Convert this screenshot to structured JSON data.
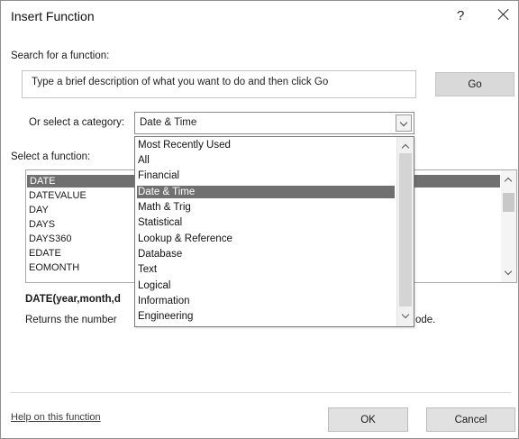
{
  "dialog": {
    "title": "Insert Function",
    "help_label": "?"
  },
  "search": {
    "label": "Search for a function:",
    "value": "Type a brief description of what you want to do and then click Go",
    "go_label": "Go"
  },
  "category": {
    "label": "Or select a category:",
    "selected": "Date & Time",
    "options": [
      "Most Recently Used",
      "All",
      "Financial",
      "Date & Time",
      "Math & Trig",
      "Statistical",
      "Lookup & Reference",
      "Database",
      "Text",
      "Logical",
      "Information",
      "Engineering"
    ]
  },
  "functions": {
    "label": "Select a function:",
    "items": [
      "DATE",
      "DATEVALUE",
      "DAY",
      "DAYS",
      "DAYS360",
      "EDATE",
      "EOMONTH"
    ]
  },
  "details": {
    "signature": "DATE(year,month,d",
    "description": "Returns the number",
    "description_tail": "ode."
  },
  "footer": {
    "help_link": "Help on this function",
    "ok_label": "OK",
    "cancel_label": "Cancel"
  },
  "colors": {
    "selection": "#707070",
    "button_face": "#e1e1e1",
    "border": "#8f8f8f"
  }
}
